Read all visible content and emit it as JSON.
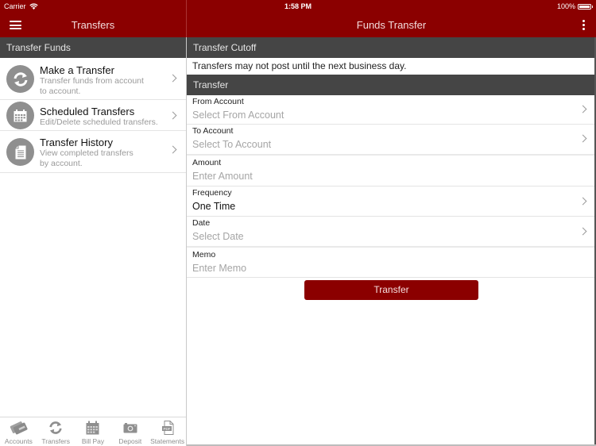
{
  "status_bar": {
    "carrier": "Carrier",
    "time": "1:58 PM",
    "battery": "100%",
    "battery_level": 1.0
  },
  "left_panel": {
    "title": "Transfers",
    "menu_icon": "hamburger-menu-icon",
    "section_header": "Transfer Funds",
    "items": [
      {
        "title": "Make a Transfer",
        "description_line1": "Transfer funds from account",
        "description_line2": "to account.",
        "icon": "transfer-sync-icon"
      },
      {
        "title": "Scheduled Transfers",
        "description_line1": "Edit/Delete scheduled transfers.",
        "description_line2": "",
        "icon": "calendar-icon"
      },
      {
        "title": "Transfer History",
        "description_line1": "View completed transfers",
        "description_line2": "by account.",
        "icon": "document-icon"
      }
    ]
  },
  "tab_bar": {
    "tabs": [
      {
        "label": "Accounts",
        "icon": "cards-icon"
      },
      {
        "label": "Transfers",
        "icon": "transfer-sync-icon"
      },
      {
        "label": "Bill Pay",
        "icon": "calendar-icon"
      },
      {
        "label": "Deposit",
        "icon": "camera-icon"
      },
      {
        "label": "Statements",
        "icon": "pdf-icon"
      }
    ]
  },
  "right_panel": {
    "title": "Funds Transfer",
    "more_icon": "more-vertical-icon",
    "cutoff_header": "Transfer Cutoff",
    "cutoff_notice": "Transfers may not post until the next business day.",
    "transfer_header": "Transfer",
    "fields": {
      "from_account": {
        "label": "From Account",
        "placeholder": "Select From Account"
      },
      "to_account": {
        "label": "To Account",
        "placeholder": "Select To Account"
      },
      "amount": {
        "label": "Amount",
        "placeholder": "Enter Amount"
      },
      "frequency": {
        "label": "Frequency",
        "value": "One Time"
      },
      "date": {
        "label": "Date",
        "placeholder": "Select Date"
      },
      "memo": {
        "label": "Memo",
        "placeholder": "Enter Memo"
      }
    },
    "submit_label": "Transfer"
  },
  "colors": {
    "brand_red": "#8b0000",
    "section_header_bg": "#454545",
    "icon_gray": "#8f8f8f"
  }
}
